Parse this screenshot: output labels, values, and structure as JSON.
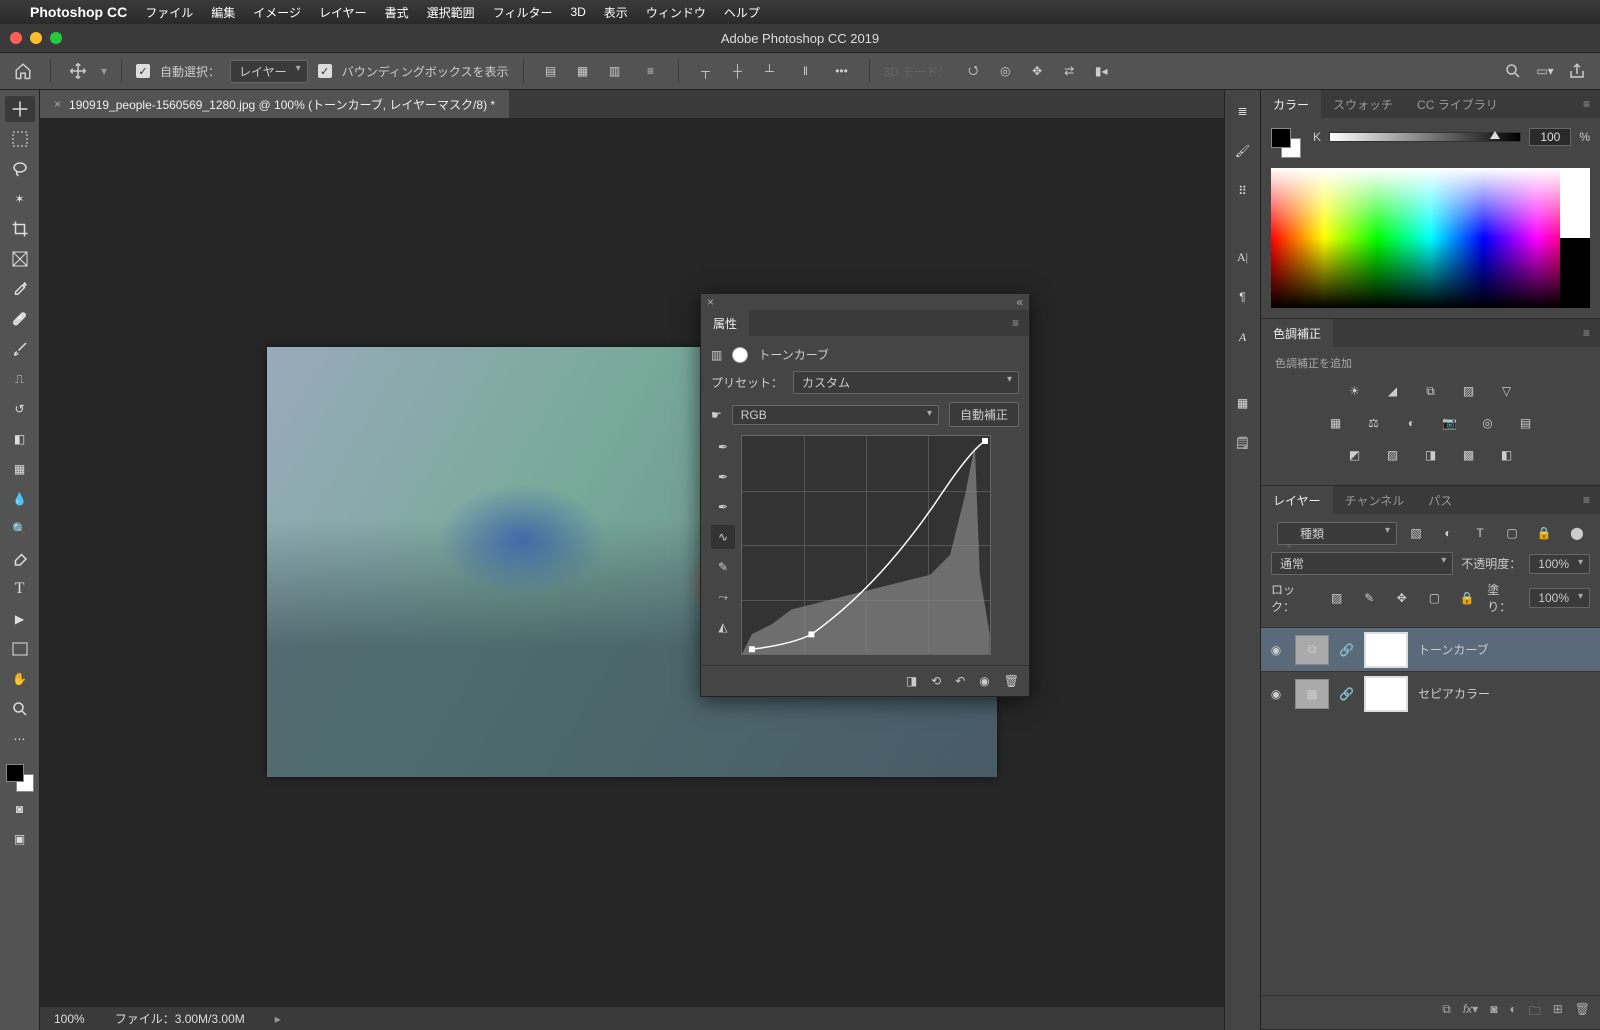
{
  "menubar": {
    "app": "Photoshop CC",
    "items": [
      "ファイル",
      "編集",
      "イメージ",
      "レイヤー",
      "書式",
      "選択範囲",
      "フィルター",
      "3D",
      "表示",
      "ウィンドウ",
      "ヘルプ"
    ]
  },
  "window": {
    "title": "Adobe Photoshop CC 2019"
  },
  "options": {
    "auto_select": "自動選択：",
    "auto_select_value": "レイヤー",
    "show_bbox": "バウンディングボックスを表示",
    "mode3d": "3D モード："
  },
  "doc_tab": {
    "name": "190919_people-1560569_1280.jpg @ 100% (トーンカーブ, レイヤーマスク/8) *"
  },
  "statusbar": {
    "zoom": "100%",
    "filesize": "ファイル：3.00M/3.00M"
  },
  "color_panel": {
    "tabs": [
      "カラー",
      "スウォッチ",
      "CC ライブラリ"
    ],
    "channel": "K",
    "value": "100",
    "unit": "%"
  },
  "adjustments_panel": {
    "title": "色調補正",
    "subtitle": "色調補正を追加"
  },
  "layers_panel": {
    "tabs": [
      "レイヤー",
      "チャンネル",
      "パス"
    ],
    "filter_label": "種類",
    "blend": "通常",
    "opacity_label": "不透明度：",
    "opacity_value": "100%",
    "lock_label": "ロック：",
    "fill_label": "塗り：",
    "fill_value": "100%",
    "layers": [
      {
        "name": "トーンカーブ"
      },
      {
        "name": "セピアカラー"
      }
    ]
  },
  "properties": {
    "tab": "属性",
    "title": "トーンカーブ",
    "preset_label": "プリセット：",
    "preset_value": "カスタム",
    "channel_value": "RGB",
    "auto_btn": "自動補正"
  }
}
